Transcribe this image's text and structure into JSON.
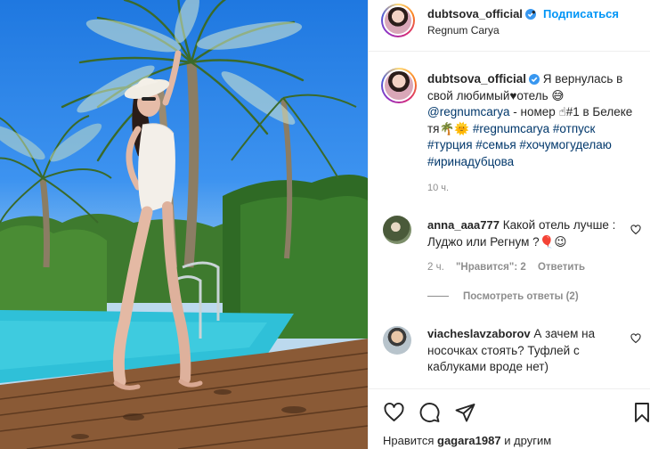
{
  "post": {
    "username": "dubtsova_official",
    "follow_label": "Подписаться",
    "location": "Regnum Carya",
    "caption": {
      "username": "dubtsova_official",
      "text_1": "Я вернулась в свой любимый♥отель 😅",
      "mention": "@regnumcarya",
      "text_2": " - номер ☝#1 в Белеке тя🌴🌞 ",
      "hashtags": "#regnumcarya #отпуск #турция #семья #хочумогуделаю #иринадубцова",
      "time": "10 ч."
    },
    "comments": [
      {
        "username": "anna_aaa777",
        "text": "Какой отель лучше : Луджо или Регнум ?🎈😉",
        "time": "2 ч.",
        "likes": "\"Нравится\": 2",
        "reply": "Ответить",
        "view_replies": "Посмотреть ответы (2)"
      },
      {
        "username": "viacheslavzaborov",
        "text": "А зачем на носочках стоять? Туфлей с каблуками вроде нет)"
      }
    ],
    "likes_prefix": "Нравится",
    "likes_user": "gagara1987",
    "likes_suffix": "и другим"
  },
  "colors": {
    "accent": "#0095f6",
    "link": "#00376b",
    "muted": "#8e8e8e",
    "text": "#262626"
  },
  "icons": [
    "verified-icon",
    "heart-icon",
    "comment-icon",
    "share-icon",
    "bookmark-icon"
  ]
}
